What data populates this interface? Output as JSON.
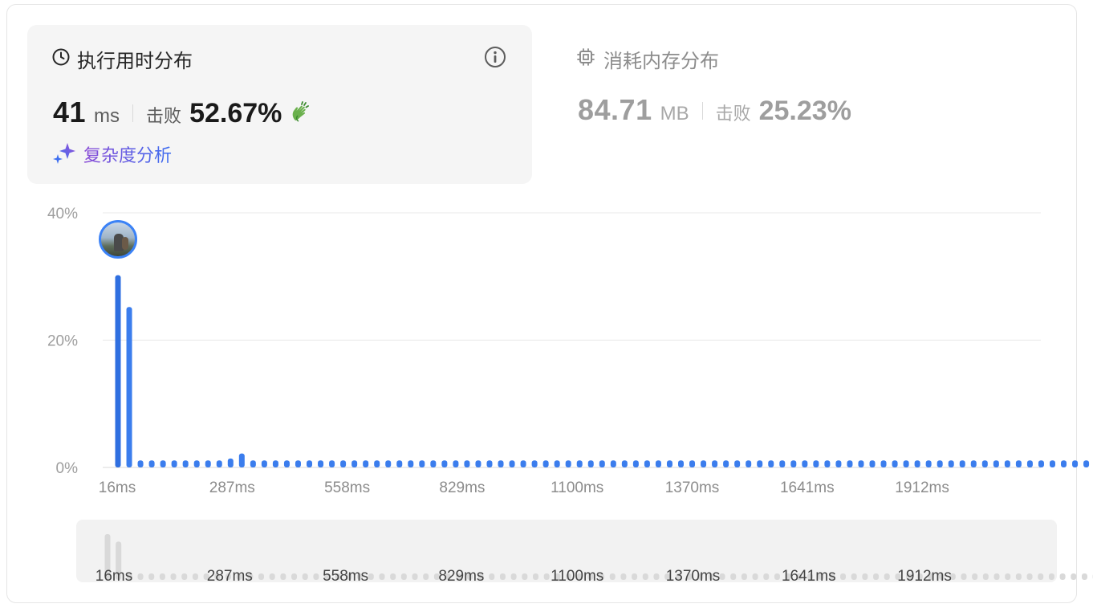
{
  "runtime": {
    "title": "执行用时分布",
    "value": "41",
    "unit": "ms",
    "beat_label": "击败",
    "beat_pct": "52.67%",
    "complexity_label": "复杂度分析"
  },
  "memory": {
    "title": "消耗内存分布",
    "value": "84.71",
    "unit": "MB",
    "beat_label": "击败",
    "beat_pct": "25.23%"
  },
  "icons": {
    "runtime": "clock-icon",
    "info": "info-icon",
    "celebrate": "clapping-hand-icon",
    "complexity": "sparkle-icon",
    "memory": "chip-icon"
  },
  "colors": {
    "bar": "#3b7ded",
    "bar_dark": "#2f6fe0",
    "navigator_bar": "#d9d9d9"
  },
  "chart_data": {
    "type": "bar",
    "ylabel_ticks": [
      "0%",
      "20%",
      "40%"
    ],
    "ylim": [
      0,
      40
    ],
    "x_tick_labels": [
      "16ms",
      "287ms",
      "558ms",
      "829ms",
      "1100ms",
      "1370ms",
      "1641ms",
      "1912ms"
    ],
    "x_tick_values": [
      16,
      287,
      558,
      829,
      1100,
      1370,
      1641,
      1912
    ],
    "x_start": 16,
    "x_step": 27.1,
    "values": [
      30.2,
      25.2,
      1.1,
      1.1,
      1.1,
      1.1,
      1.1,
      1.1,
      1.1,
      1.1,
      1.4,
      2.2,
      1.1,
      1.1,
      1.1,
      1.1,
      1.1,
      1.1,
      1.1,
      1.1,
      1.1,
      1.1,
      1.1,
      1.1,
      1.1,
      1.1,
      1.1,
      1.1,
      1.1,
      1.1,
      1.1,
      1.1,
      1.1,
      1.1,
      1.1,
      1.1,
      1.1,
      1.1,
      1.1,
      1.1,
      1.1,
      1.1,
      1.1,
      1.1,
      1.1,
      1.1,
      1.1,
      1.1,
      1.1,
      1.1,
      1.1,
      1.1,
      1.1,
      1.1,
      1.1,
      1.1,
      1.1,
      1.1,
      1.1,
      1.1,
      1.1,
      1.1,
      1.1,
      1.1,
      1.1,
      1.1,
      1.1,
      1.1,
      1.1,
      1.1,
      1.1,
      1.1,
      1.1,
      1.1,
      1.1,
      1.1,
      1.1,
      1.1,
      1.1,
      1.1,
      1.1,
      1.1,
      1.1,
      1.1,
      1.1,
      1.1,
      1.1,
      1.1,
      1.1,
      1.1,
      1.1,
      1.1,
      1.1,
      1.1,
      1.1,
      1.1,
      1.1,
      1.1,
      1.1,
      1.1,
      1.1,
      1.1,
      1.1,
      1.1,
      1.1,
      1.1,
      1.1,
      1.1,
      1.1,
      1.1,
      1.1,
      1.1,
      1.1,
      1.1,
      1.1,
      1.1,
      1.1,
      1.1
    ],
    "highlighted_index": 0,
    "grid": true
  }
}
